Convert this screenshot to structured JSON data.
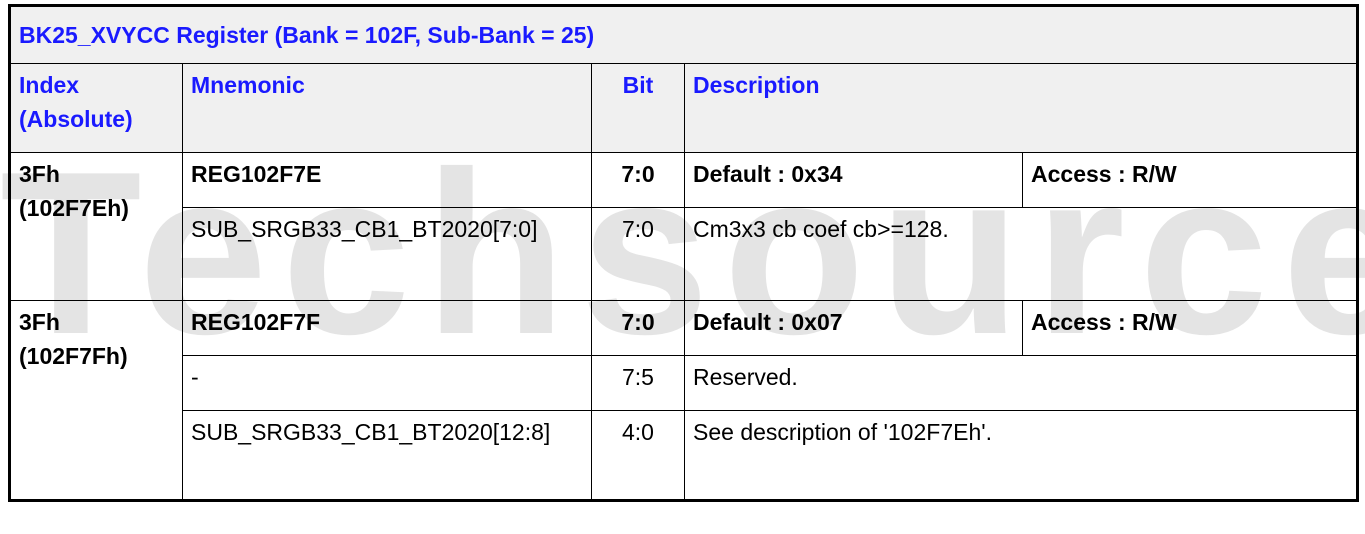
{
  "watermark": "Techsource",
  "table": {
    "title": "BK25_XVYCC Register (Bank = 102F, Sub-Bank = 25)",
    "headers": {
      "index": "Index (Absolute)",
      "mnemonic": "Mnemonic",
      "bit": "Bit",
      "description": "Description"
    },
    "registers": [
      {
        "index": "3Fh (102F7Eh)",
        "name": "REG102F7E",
        "bits": "7:0",
        "default": "Default : 0x34",
        "access": "Access : R/W",
        "fields": [
          {
            "mnemonic": "SUB_SRGB33_CB1_BT2020[7:0]",
            "bits": "7:0",
            "description": "Cm3x3 cb coef cb>=128."
          }
        ]
      },
      {
        "index": "3Fh (102F7Fh)",
        "name": "REG102F7F",
        "bits": "7:0",
        "default": "Default : 0x07",
        "access": "Access : R/W",
        "fields": [
          {
            "mnemonic": "-",
            "bits": "7:5",
            "description": "Reserved."
          },
          {
            "mnemonic": "SUB_SRGB33_CB1_BT2020[12:8]",
            "bits": "4:0",
            "description": "See description of '102F7Eh'."
          }
        ]
      }
    ]
  }
}
